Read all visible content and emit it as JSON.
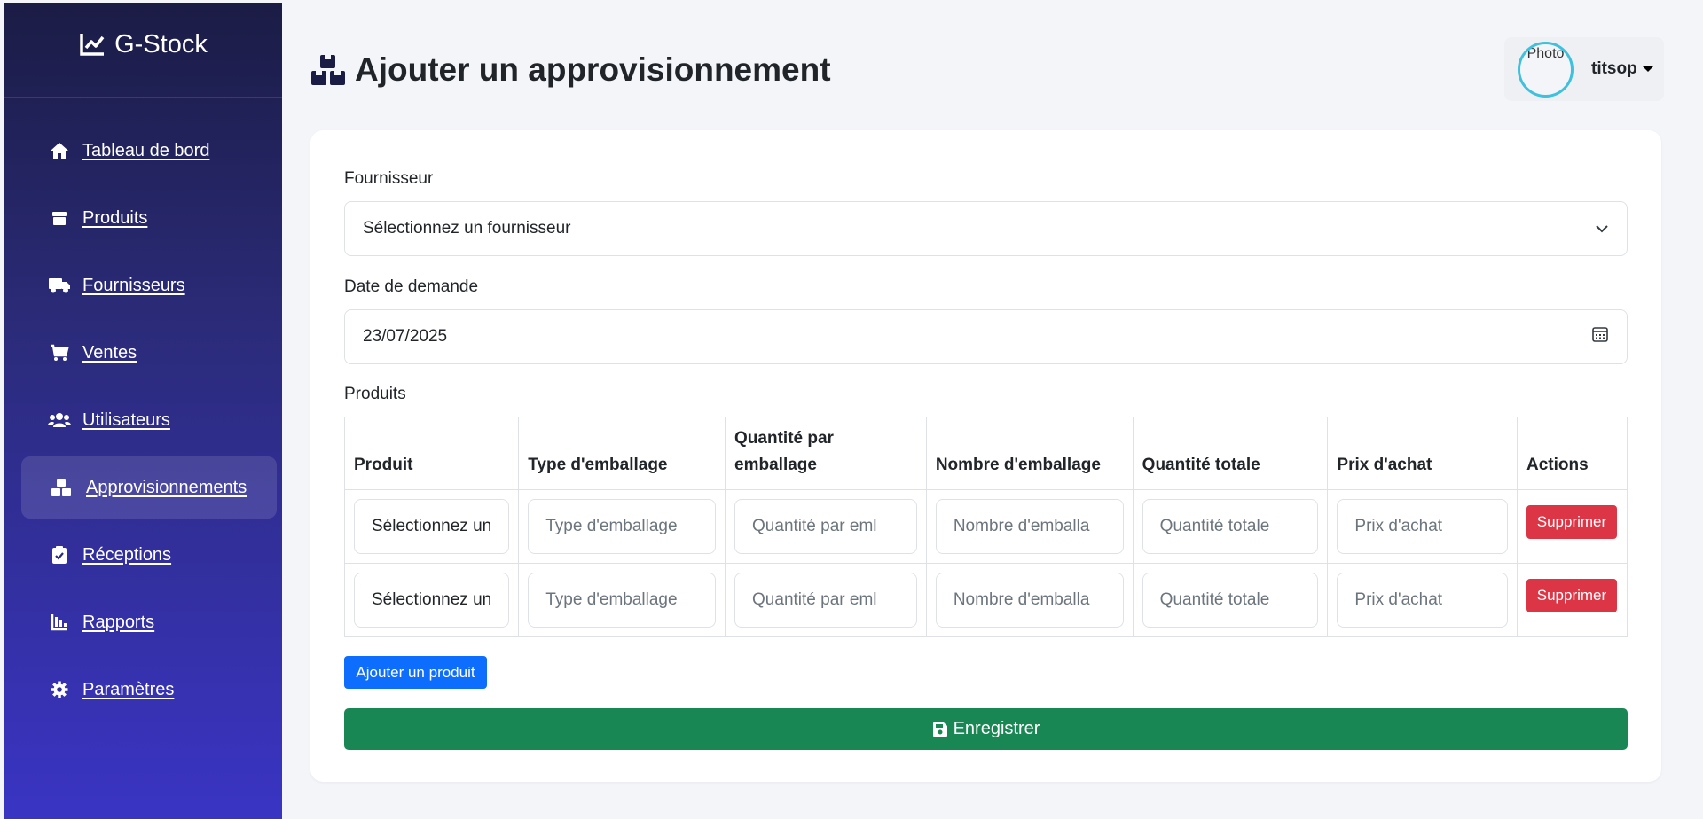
{
  "brand": {
    "name": "G-Stock"
  },
  "sidebar": {
    "items": [
      {
        "label": "Tableau de bord",
        "icon": "home-icon"
      },
      {
        "label": "Produits",
        "icon": "box-icon"
      },
      {
        "label": "Fournisseurs",
        "icon": "truck-icon"
      },
      {
        "label": "Ventes",
        "icon": "cart-icon"
      },
      {
        "label": "Utilisateurs",
        "icon": "users-icon"
      },
      {
        "label": "Approvisionnements",
        "icon": "boxes-icon",
        "active": true
      },
      {
        "label": "Réceptions",
        "icon": "clipboard-check-icon"
      },
      {
        "label": "Rapports",
        "icon": "chart-icon"
      },
      {
        "label": "Paramètres",
        "icon": "gear-icon"
      }
    ]
  },
  "header": {
    "title": "Ajouter un approvisionnement",
    "user_name": "titsop",
    "avatar_alt": "Photo"
  },
  "form": {
    "supplier_label": "Fournisseur",
    "supplier_value": "Sélectionnez un fournisseur",
    "date_label": "Date de demande",
    "date_value": "23/07/2025",
    "products_label": "Produits",
    "columns": [
      "Produit",
      "Type d'emballage",
      "Quantité par emballage",
      "Nombre d'emballage",
      "Quantité totale",
      "Prix d'achat",
      "Actions"
    ],
    "rows": [
      {
        "product": "Sélectionnez un",
        "packaging_type": "Type d'emballage",
        "qty_per_pack": "Quantité par eml",
        "pack_count": "Nombre d'emballa",
        "total_qty": "Quantité totale",
        "price": "Prix d'achat",
        "delete_label": "Supprimer"
      },
      {
        "product": "Sélectionnez un",
        "packaging_type": "Type d'emballage",
        "qty_per_pack": "Quantité par eml",
        "pack_count": "Nombre d'emballa",
        "total_qty": "Quantité totale",
        "price": "Prix d'achat",
        "delete_label": "Supprimer"
      }
    ],
    "add_product_label": "Ajouter un produit",
    "save_label": "Enregistrer"
  },
  "colors": {
    "accent_blue": "#0d6efd",
    "danger": "#dc3545",
    "success": "#198754",
    "sidebar_top": "#1b1c45",
    "sidebar_bottom": "#3a34c4"
  }
}
